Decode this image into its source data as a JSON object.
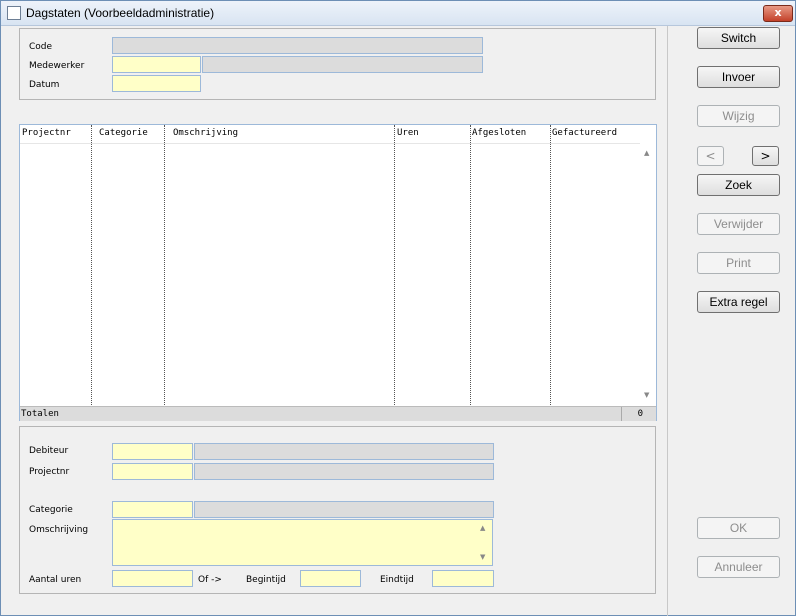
{
  "window": {
    "title": "Dagstaten (Voorbeeldadministratie)",
    "close": "x"
  },
  "header_form": {
    "code_label": "Code",
    "medewerker_label": "Medewerker",
    "datum_label": "Datum"
  },
  "grid": {
    "columns": [
      "Projectnr",
      "Categorie",
      "Omschrijving",
      "Uren",
      "Afgesloten",
      "Gefactureerd"
    ],
    "totals_label": "Totalen",
    "totals_value": "0"
  },
  "detail_form": {
    "debiteur_label": "Debiteur",
    "projectnr_label": "Projectnr",
    "categorie_label": "Categorie",
    "omschrijving_label": "Omschrijving",
    "aantal_uren_label": "Aantal uren",
    "of_label": "Of ->",
    "begintijd_label": "Begintijd",
    "eindtijd_label": "Eindtijd"
  },
  "sidebar": {
    "switch": "Switch",
    "invoer": "Invoer",
    "wijzig": "Wijzig",
    "prev": "<",
    "next": ">",
    "zoek": "Zoek",
    "verwijder": "Verwijder",
    "print": "Print",
    "extra_regel": "Extra regel",
    "ok": "OK",
    "annuleer": "Annuleer"
  },
  "colors": {
    "input_bg": "#ffffc8",
    "readonly_bg": "#dcdcdc",
    "field_border": "#9db9d9"
  }
}
